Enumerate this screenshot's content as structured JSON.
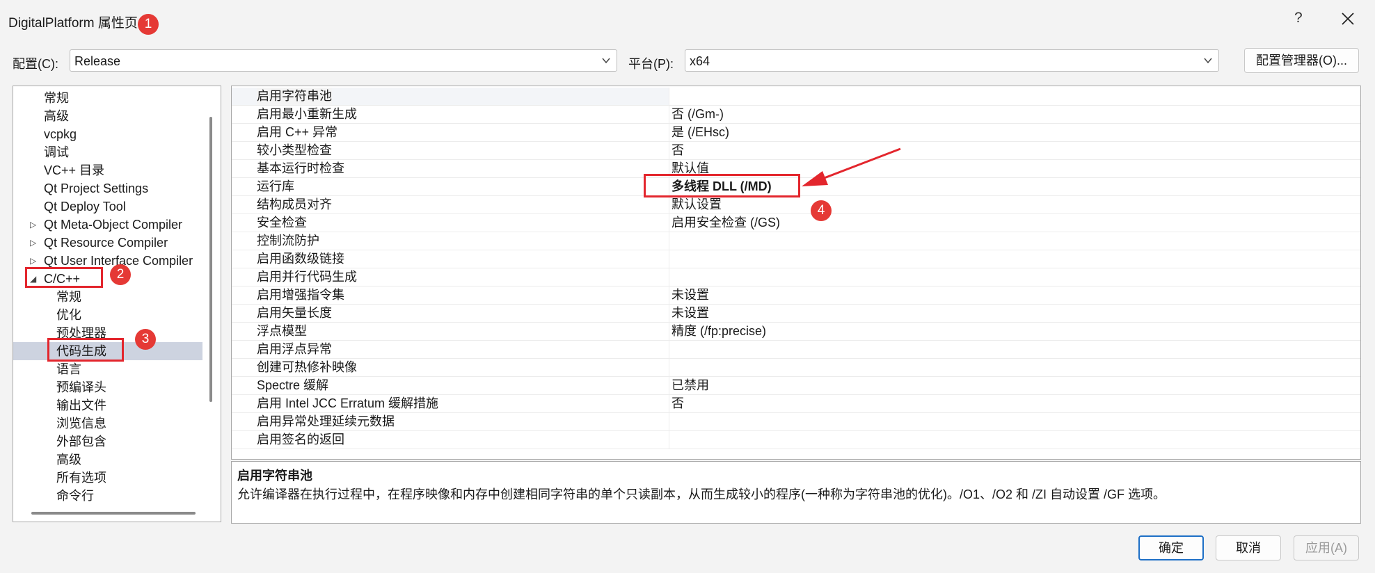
{
  "window": {
    "title": "DigitalPlatform 属性页",
    "help_glyph": "?",
    "close_icon": "close-icon"
  },
  "annotations": {
    "badge_1": "1",
    "badge_2": "2",
    "badge_3": "3",
    "badge_4": "4",
    "color": "#e3262d"
  },
  "toolbar": {
    "config_label": "配置(C):",
    "config_value": "Release",
    "platform_label": "平台(P):",
    "platform_value": "x64",
    "config_manager_label": "配置管理器(O)..."
  },
  "tree": {
    "items": [
      {
        "label": "常规",
        "arrow": ""
      },
      {
        "label": "高级",
        "arrow": ""
      },
      {
        "label": "vcpkg",
        "arrow": ""
      },
      {
        "label": "调试",
        "arrow": ""
      },
      {
        "label": "VC++ 目录",
        "arrow": ""
      },
      {
        "label": "Qt Project Settings",
        "arrow": ""
      },
      {
        "label": "Qt Deploy Tool",
        "arrow": ""
      },
      {
        "label": "Qt Meta-Object Compiler",
        "arrow": "▷"
      },
      {
        "label": "Qt Resource Compiler",
        "arrow": "▷"
      },
      {
        "label": "Qt User Interface Compiler",
        "arrow": "▷"
      },
      {
        "label": "C/C++",
        "arrow": "◢"
      },
      {
        "label": "常规",
        "arrow": ""
      },
      {
        "label": "优化",
        "arrow": ""
      },
      {
        "label": "预处理器",
        "arrow": ""
      },
      {
        "label": "代码生成",
        "arrow": ""
      },
      {
        "label": "语言",
        "arrow": ""
      },
      {
        "label": "预编译头",
        "arrow": ""
      },
      {
        "label": "输出文件",
        "arrow": ""
      },
      {
        "label": "浏览信息",
        "arrow": ""
      },
      {
        "label": "外部包含",
        "arrow": ""
      },
      {
        "label": "高级",
        "arrow": ""
      },
      {
        "label": "所有选项",
        "arrow": ""
      },
      {
        "label": "命令行",
        "arrow": ""
      }
    ],
    "selected_label": "代码生成"
  },
  "properties": {
    "rows": [
      {
        "name": "启用字符串池",
        "value": ""
      },
      {
        "name": "启用最小重新生成",
        "value": "否 (/Gm-)"
      },
      {
        "name": "启用 C++ 异常",
        "value": "是 (/EHsc)"
      },
      {
        "name": "较小类型检查",
        "value": "否"
      },
      {
        "name": "基本运行时检查",
        "value": "默认值"
      },
      {
        "name": "运行库",
        "value": "多线程 DLL (/MD)"
      },
      {
        "name": "结构成员对齐",
        "value": "默认设置"
      },
      {
        "name": "安全检查",
        "value": "启用安全检查 (/GS)"
      },
      {
        "name": "控制流防护",
        "value": ""
      },
      {
        "name": "启用函数级链接",
        "value": ""
      },
      {
        "name": "启用并行代码生成",
        "value": ""
      },
      {
        "name": "启用增强指令集",
        "value": "未设置"
      },
      {
        "name": "启用矢量长度",
        "value": "未设置"
      },
      {
        "name": "浮点模型",
        "value": "精度 (/fp:precise)"
      },
      {
        "name": "启用浮点异常",
        "value": ""
      },
      {
        "name": "创建可热修补映像",
        "value": ""
      },
      {
        "name": "Spectre 缓解",
        "value": "已禁用"
      },
      {
        "name": "启用 Intel JCC Erratum 缓解措施",
        "value": "否"
      },
      {
        "name": "启用异常处理延续元数据",
        "value": ""
      },
      {
        "name": "启用签名的返回",
        "value": ""
      }
    ]
  },
  "description": {
    "title": "启用字符串池",
    "body": "允许编译器在执行过程中，在程序映像和内存中创建相同字符串的单个只读副本，从而生成较小的程序(一种称为字符串池的优化)。/O1、/O2 和 /ZI 自动设置 /GF 选项。"
  },
  "footer": {
    "ok_label": "确定",
    "cancel_label": "取消",
    "apply_label": "应用(A)"
  }
}
